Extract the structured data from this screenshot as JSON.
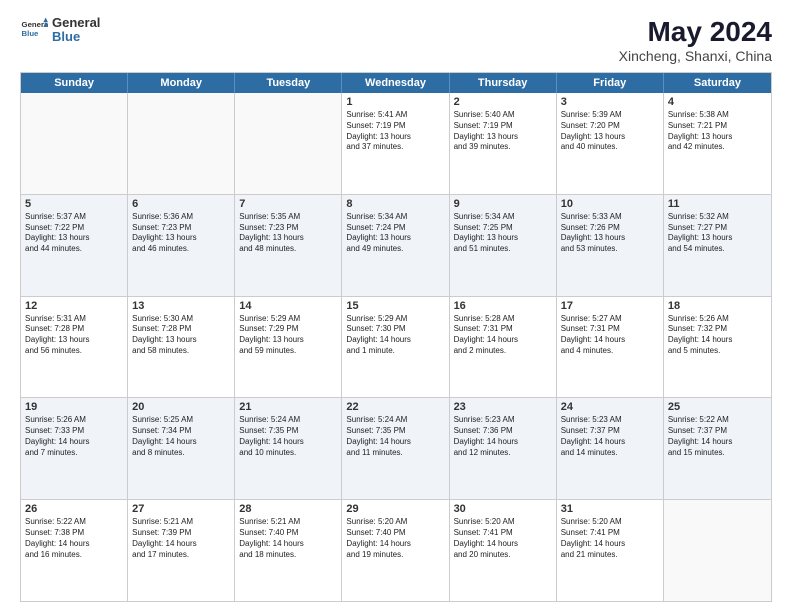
{
  "header": {
    "logo": {
      "line1": "General",
      "line2": "Blue"
    },
    "title": "May 2024",
    "subtitle": "Xincheng, Shanxi, China"
  },
  "days": [
    "Sunday",
    "Monday",
    "Tuesday",
    "Wednesday",
    "Thursday",
    "Friday",
    "Saturday"
  ],
  "weeks": [
    [
      {
        "day": "",
        "text": "",
        "empty": true
      },
      {
        "day": "",
        "text": "",
        "empty": true
      },
      {
        "day": "",
        "text": "",
        "empty": true
      },
      {
        "day": "1",
        "text": "Sunrise: 5:41 AM\nSunset: 7:19 PM\nDaylight: 13 hours\nand 37 minutes."
      },
      {
        "day": "2",
        "text": "Sunrise: 5:40 AM\nSunset: 7:19 PM\nDaylight: 13 hours\nand 39 minutes."
      },
      {
        "day": "3",
        "text": "Sunrise: 5:39 AM\nSunset: 7:20 PM\nDaylight: 13 hours\nand 40 minutes."
      },
      {
        "day": "4",
        "text": "Sunrise: 5:38 AM\nSunset: 7:21 PM\nDaylight: 13 hours\nand 42 minutes."
      }
    ],
    [
      {
        "day": "5",
        "text": "Sunrise: 5:37 AM\nSunset: 7:22 PM\nDaylight: 13 hours\nand 44 minutes."
      },
      {
        "day": "6",
        "text": "Sunrise: 5:36 AM\nSunset: 7:23 PM\nDaylight: 13 hours\nand 46 minutes."
      },
      {
        "day": "7",
        "text": "Sunrise: 5:35 AM\nSunset: 7:23 PM\nDaylight: 13 hours\nand 48 minutes."
      },
      {
        "day": "8",
        "text": "Sunrise: 5:34 AM\nSunset: 7:24 PM\nDaylight: 13 hours\nand 49 minutes."
      },
      {
        "day": "9",
        "text": "Sunrise: 5:34 AM\nSunset: 7:25 PM\nDaylight: 13 hours\nand 51 minutes."
      },
      {
        "day": "10",
        "text": "Sunrise: 5:33 AM\nSunset: 7:26 PM\nDaylight: 13 hours\nand 53 minutes."
      },
      {
        "day": "11",
        "text": "Sunrise: 5:32 AM\nSunset: 7:27 PM\nDaylight: 13 hours\nand 54 minutes."
      }
    ],
    [
      {
        "day": "12",
        "text": "Sunrise: 5:31 AM\nSunset: 7:28 PM\nDaylight: 13 hours\nand 56 minutes."
      },
      {
        "day": "13",
        "text": "Sunrise: 5:30 AM\nSunset: 7:28 PM\nDaylight: 13 hours\nand 58 minutes."
      },
      {
        "day": "14",
        "text": "Sunrise: 5:29 AM\nSunset: 7:29 PM\nDaylight: 13 hours\nand 59 minutes."
      },
      {
        "day": "15",
        "text": "Sunrise: 5:29 AM\nSunset: 7:30 PM\nDaylight: 14 hours\nand 1 minute."
      },
      {
        "day": "16",
        "text": "Sunrise: 5:28 AM\nSunset: 7:31 PM\nDaylight: 14 hours\nand 2 minutes."
      },
      {
        "day": "17",
        "text": "Sunrise: 5:27 AM\nSunset: 7:31 PM\nDaylight: 14 hours\nand 4 minutes."
      },
      {
        "day": "18",
        "text": "Sunrise: 5:26 AM\nSunset: 7:32 PM\nDaylight: 14 hours\nand 5 minutes."
      }
    ],
    [
      {
        "day": "19",
        "text": "Sunrise: 5:26 AM\nSunset: 7:33 PM\nDaylight: 14 hours\nand 7 minutes."
      },
      {
        "day": "20",
        "text": "Sunrise: 5:25 AM\nSunset: 7:34 PM\nDaylight: 14 hours\nand 8 minutes."
      },
      {
        "day": "21",
        "text": "Sunrise: 5:24 AM\nSunset: 7:35 PM\nDaylight: 14 hours\nand 10 minutes."
      },
      {
        "day": "22",
        "text": "Sunrise: 5:24 AM\nSunset: 7:35 PM\nDaylight: 14 hours\nand 11 minutes."
      },
      {
        "day": "23",
        "text": "Sunrise: 5:23 AM\nSunset: 7:36 PM\nDaylight: 14 hours\nand 12 minutes."
      },
      {
        "day": "24",
        "text": "Sunrise: 5:23 AM\nSunset: 7:37 PM\nDaylight: 14 hours\nand 14 minutes."
      },
      {
        "day": "25",
        "text": "Sunrise: 5:22 AM\nSunset: 7:37 PM\nDaylight: 14 hours\nand 15 minutes."
      }
    ],
    [
      {
        "day": "26",
        "text": "Sunrise: 5:22 AM\nSunset: 7:38 PM\nDaylight: 14 hours\nand 16 minutes."
      },
      {
        "day": "27",
        "text": "Sunrise: 5:21 AM\nSunset: 7:39 PM\nDaylight: 14 hours\nand 17 minutes."
      },
      {
        "day": "28",
        "text": "Sunrise: 5:21 AM\nSunset: 7:40 PM\nDaylight: 14 hours\nand 18 minutes."
      },
      {
        "day": "29",
        "text": "Sunrise: 5:20 AM\nSunset: 7:40 PM\nDaylight: 14 hours\nand 19 minutes."
      },
      {
        "day": "30",
        "text": "Sunrise: 5:20 AM\nSunset: 7:41 PM\nDaylight: 14 hours\nand 20 minutes."
      },
      {
        "day": "31",
        "text": "Sunrise: 5:20 AM\nSunset: 7:41 PM\nDaylight: 14 hours\nand 21 minutes."
      },
      {
        "day": "",
        "text": "",
        "empty": true
      }
    ]
  ]
}
